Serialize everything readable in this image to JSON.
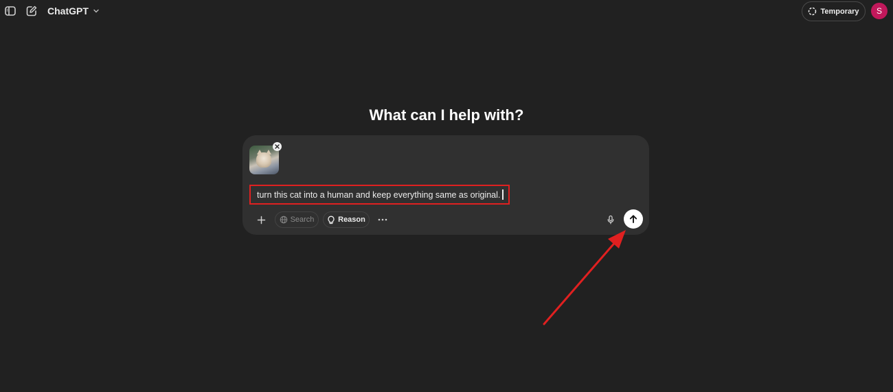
{
  "header": {
    "model_name": "ChatGPT",
    "temporary_label": "Temporary",
    "avatar_initial": "S"
  },
  "main": {
    "heading": "What can I help with?"
  },
  "composer": {
    "prompt_text": "turn this cat into a human and keep everything same as original.",
    "tools": {
      "search_label": "Search",
      "reason_label": "Reason"
    }
  },
  "colors": {
    "background": "#212121",
    "composer": "#303030",
    "highlight_box": "#e02020",
    "annotation_arrow": "#e02020",
    "avatar": "#c2185b"
  },
  "icons": {
    "sidebar_toggle": "sidebar-toggle-icon",
    "new_chat": "compose-icon",
    "model_dropdown": "chevron-down-icon",
    "temporary": "dashed-circle-icon",
    "remove_attachment": "close-icon",
    "add": "plus-icon",
    "search": "globe-icon",
    "reason": "lightbulb-icon",
    "more": "ellipsis-icon",
    "voice": "microphone-icon",
    "send": "arrow-up-icon"
  }
}
